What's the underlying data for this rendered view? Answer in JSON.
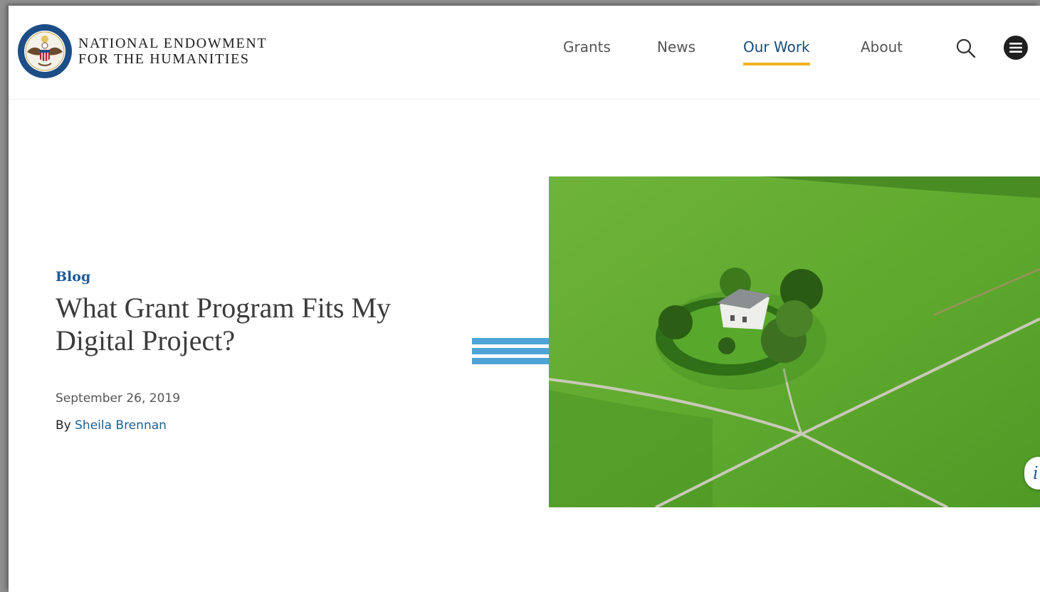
{
  "header": {
    "org_line1": "NATIONAL ENDOWMENT",
    "org_line2": "FOR THE HUMANITIES",
    "nav": [
      {
        "label": "Grants",
        "active": false
      },
      {
        "label": "News",
        "active": false
      },
      {
        "label": "Our Work",
        "active": true
      },
      {
        "label": "About",
        "active": false
      }
    ],
    "icons": {
      "search": "search-icon",
      "menu": "menu-icon",
      "logo": "neh-seal-icon"
    }
  },
  "article": {
    "category": "Blog",
    "title": "What Grant Program Fits My Digital Project?",
    "date": "September 26, 2019",
    "by_label": "By",
    "author": "Sheila Brennan"
  },
  "info_button": {
    "label": "i"
  },
  "colors": {
    "accent_underline": "#f0b323",
    "category_blue": "#1c5b96",
    "stripe_blue": "#4ea4d6",
    "link_blue": "#1e5f8e"
  }
}
